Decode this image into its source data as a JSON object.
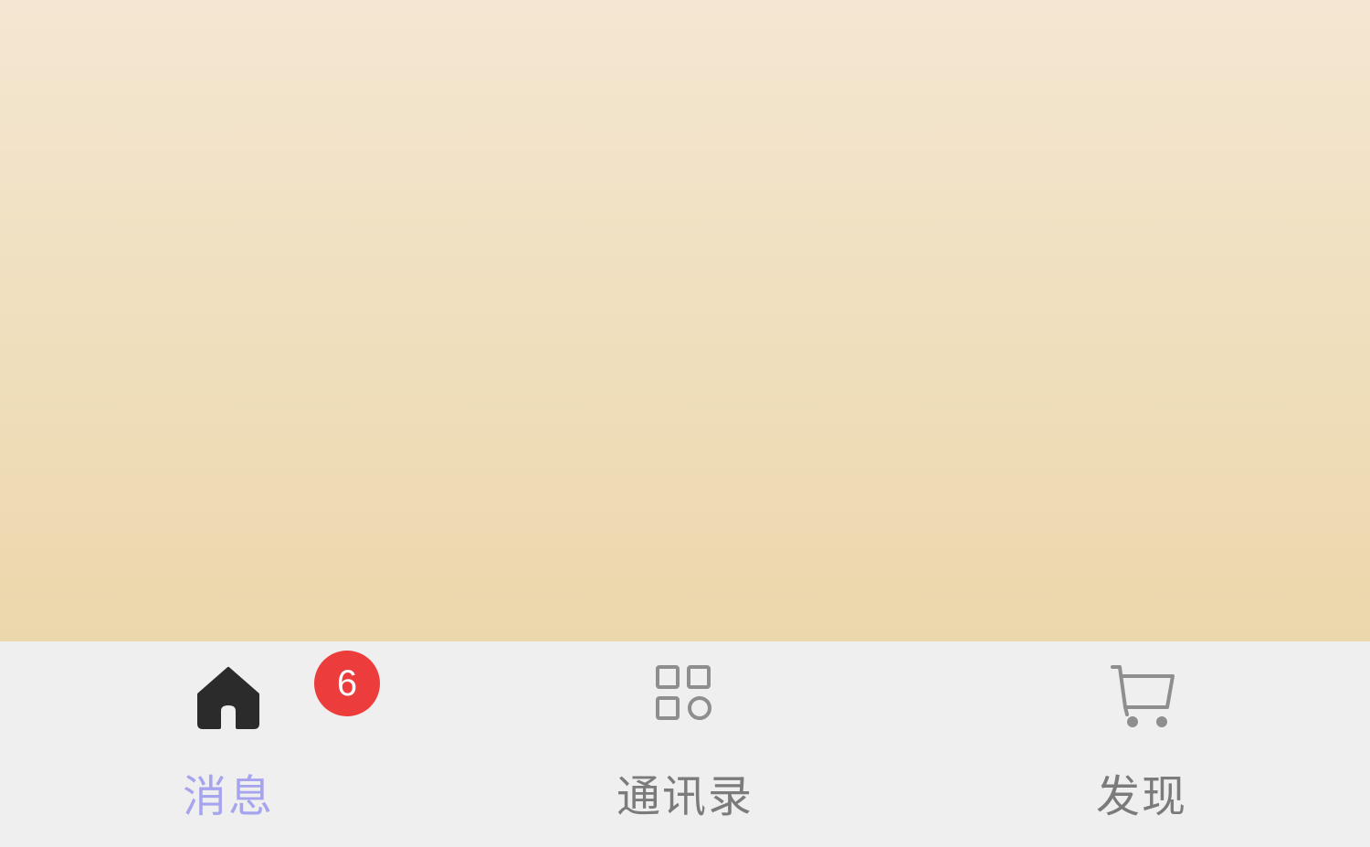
{
  "tabbar": {
    "tabs": [
      {
        "label": "消息",
        "icon": "home-icon",
        "active": true,
        "badge": "6"
      },
      {
        "label": "通讯录",
        "icon": "apps-grid-icon",
        "active": false
      },
      {
        "label": "发现",
        "icon": "shopping-cart-icon",
        "active": false
      }
    ]
  },
  "colors": {
    "active_label": "#a6a4ef",
    "inactive_label": "#7b7b7b",
    "active_icon": "#2b2b2b",
    "inactive_icon": "#8e8e8e",
    "badge_bg": "#ec3c3c",
    "badge_text": "#ffffff",
    "tabbar_bg": "#efefef"
  }
}
